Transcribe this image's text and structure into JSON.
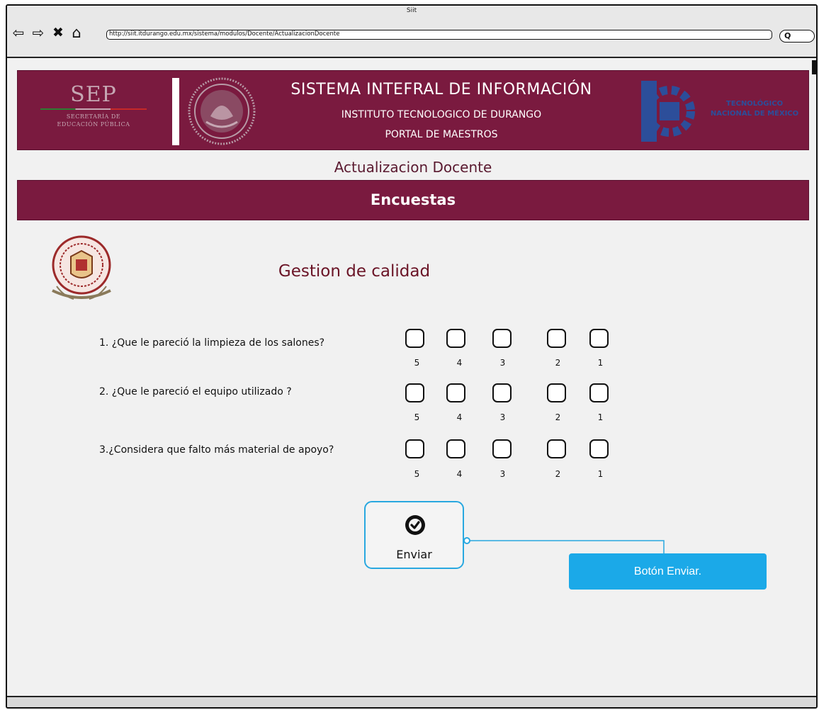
{
  "browser": {
    "window_title": "Siit",
    "url": "http://siit.itdurango.edu.mx/sistema/modulos/Docente/ActualizacionDocente",
    "search_icon": "Q"
  },
  "header": {
    "sep_logo_text": "SEP",
    "sep_logo_subtext_1": "SECRETARÍA DE",
    "sep_logo_subtext_2": "EDUCACIÓN PÚBLICA",
    "title": "SISTEMA INTEFRAL DE INFORMACIÓN",
    "subtitle_1": "INSTITUTO TECNOLOGICO DE DURANGO",
    "subtitle_2": "PORTAL DE MAESTROS",
    "tec_logo_text_1": "TECNOLÓGICO",
    "tec_logo_text_2": "NACIONAL DE MÉXICO"
  },
  "page": {
    "subtitle": "Actualizacion Docente",
    "section_title": "Encuestas",
    "survey_title": "Gestion de calidad"
  },
  "questions": [
    {
      "label": "1. ¿Que le pareció la limpieza de los salones?",
      "options": [
        "5",
        "4",
        "3",
        "2",
        "1"
      ]
    },
    {
      "label": "2. ¿Que le pareció el equipo utilizado ?",
      "options": [
        "5",
        "4",
        "3",
        "2",
        "1"
      ]
    },
    {
      "label": "3.¿Considera que falto más material de apoyo?",
      "options": [
        "5",
        "4",
        "3",
        "2",
        "1"
      ]
    }
  ],
  "send_button": {
    "label": "Enviar",
    "icon": "check-circle-icon"
  },
  "annotation": {
    "text": "Botón Enviar."
  },
  "colors": {
    "brand_maroon": "#7a1a3f",
    "accent_blue": "#1ba9e8",
    "title_red": "#6a1426"
  }
}
